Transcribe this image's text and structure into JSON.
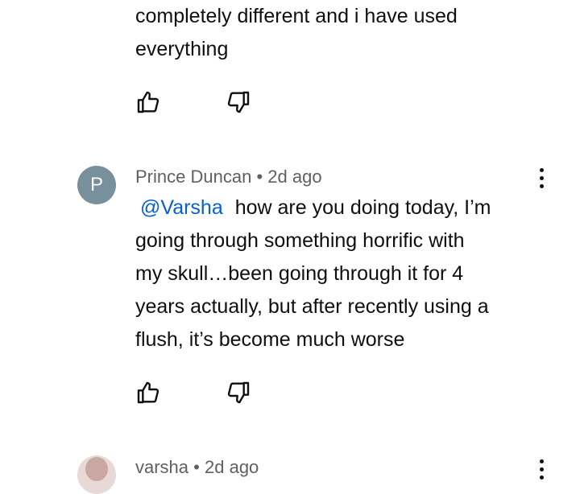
{
  "previous_comment": {
    "lines": [
      "completely different and i have used",
      "everything"
    ]
  },
  "comment_1": {
    "avatar_letter": "P",
    "author": "Prince Duncan",
    "separator": "•",
    "time": "2d ago",
    "mention": "@Varsha",
    "lines_first": "how are you doing today, I’m",
    "lines": [
      "going through something horrific with",
      "my skull…been going through it for 4",
      "years actually, but after recently using a",
      "flush, it’s become much worse"
    ]
  },
  "comment_2": {
    "author": "varsha",
    "separator": "•",
    "time": "2d ago"
  },
  "icons": {
    "like": "thumbs-up-outline",
    "dislike": "thumbs-down-outline",
    "more": "vertical-ellipsis"
  }
}
